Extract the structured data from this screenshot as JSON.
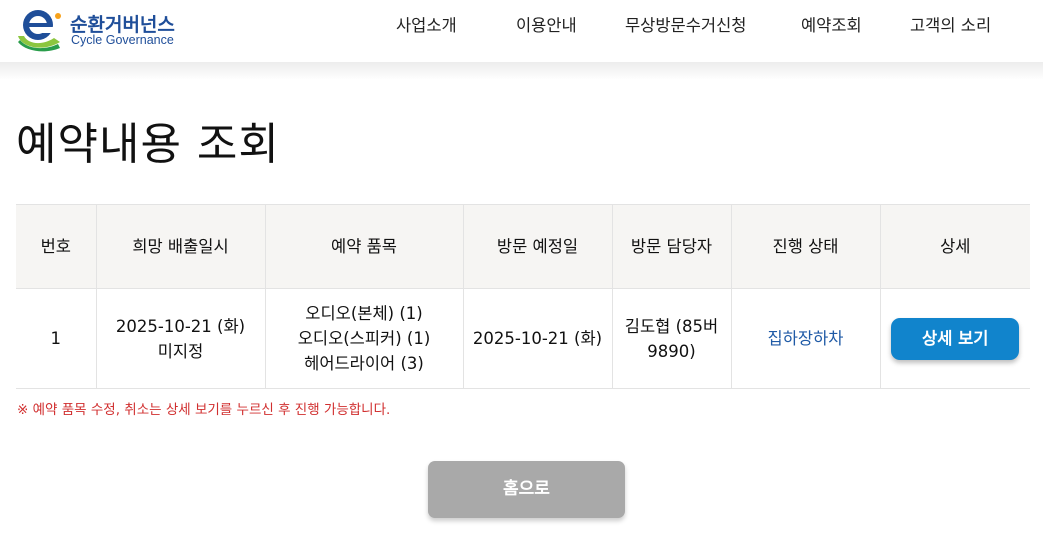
{
  "brand": {
    "name": "순환거버넌스",
    "subtitle": "Cycle Governance"
  },
  "nav": [
    {
      "label": "사업소개"
    },
    {
      "label": "이용안내"
    },
    {
      "label": "무상방문수거신청"
    },
    {
      "label": "예약조회"
    },
    {
      "label": "고객의 소리"
    }
  ],
  "page_title": "예약내용 조회",
  "table": {
    "headers": [
      "번호",
      "희망 배출일시",
      "예약 품목",
      "방문 예정일",
      "방문 담당자",
      "진행 상태",
      "상세"
    ],
    "rows": [
      {
        "no": "1",
        "requested_date": "2025-10-21 (화)",
        "requested_time": "미지정",
        "items": [
          "오디오(본체) (1)",
          "오디오(스피커) (1)",
          "헤어드라이어 (3)"
        ],
        "visit_date": "2025-10-21 (화)",
        "staff": "김도협 (85버9890)",
        "status": "집하장하차",
        "detail_label": "상세 보기"
      }
    ]
  },
  "notice": "※ 예약 품목 수정, 취소는 상세 보기를 누르신 후 진행 가능합니다.",
  "home_button": "홈으로",
  "colors": {
    "brand_blue": "#1f4e99",
    "button_blue": "#1184cc",
    "status_blue": "#1f5aa6",
    "notice_red": "#d12f2f",
    "home_gray": "#a9a9a9",
    "header_bg": "#f6f5f3"
  }
}
